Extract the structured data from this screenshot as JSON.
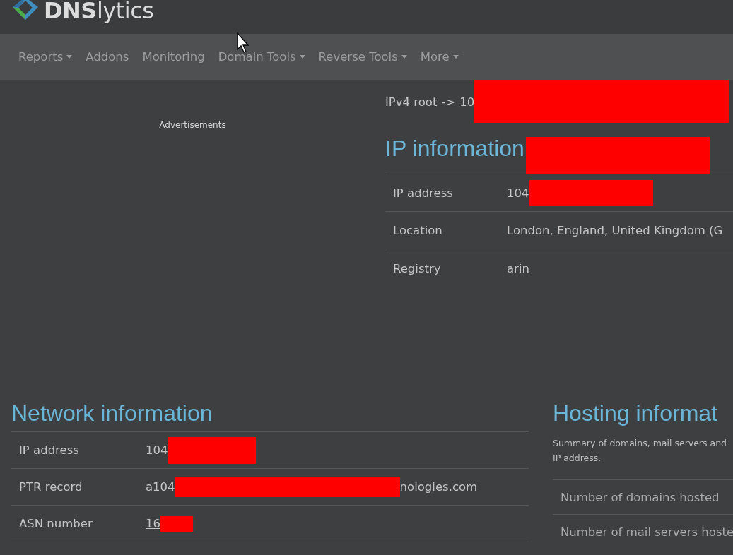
{
  "brand": {
    "bold": "DNS",
    "light": "lytics"
  },
  "nav": [
    {
      "label": "Reports",
      "dropdown": true
    },
    {
      "label": "Addons",
      "dropdown": false
    },
    {
      "label": "Monitoring",
      "dropdown": false
    },
    {
      "label": "Domain Tools",
      "dropdown": true
    },
    {
      "label": "Reverse Tools",
      "dropdown": true
    },
    {
      "label": "More",
      "dropdown": true
    }
  ],
  "ads": {
    "label": "Advertisements"
  },
  "breadcrumb": [
    {
      "kind": "link",
      "text": "IPv4 root"
    },
    {
      "kind": "text",
      "text": "->"
    },
    {
      "kind": "link",
      "text": "10",
      "redacted": true
    }
  ],
  "ip_info": {
    "title": "IP information",
    "title_redacted": true,
    "rows": [
      {
        "label": "IP address",
        "value": "104",
        "redacted": true,
        "link": false
      },
      {
        "label": "Location",
        "value": "London, England, United Kingdom (G",
        "redacted": false,
        "link": false
      },
      {
        "label": "Registry",
        "value": "arin",
        "redacted": false,
        "link": false
      }
    ]
  },
  "network_info": {
    "title": "Network information",
    "rows": [
      {
        "label": "IP address",
        "value": "104",
        "redacted": true,
        "link": false
      },
      {
        "label": "PTR record",
        "value": "a104",
        "redacted": true,
        "after": "nologies.com",
        "link": false
      },
      {
        "label": "ASN number",
        "value": "16",
        "redacted": true,
        "link": true
      }
    ]
  },
  "hosting_info": {
    "title": "Hosting informat",
    "summary": [
      "Summary of domains, mail servers and",
      "IP address."
    ],
    "rows": [
      {
        "label": "Number of domains hosted"
      },
      {
        "label": "Number of mail servers hoste"
      }
    ]
  }
}
